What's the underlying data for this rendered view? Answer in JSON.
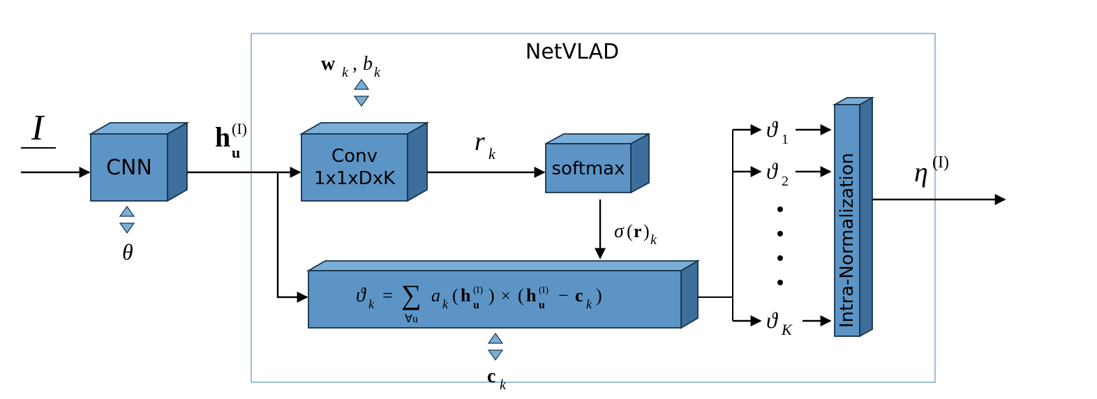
{
  "diagram": {
    "title": "NetVLAD",
    "input_symbol": "I",
    "cnn_label": "CNN",
    "cnn_param": "θ",
    "feature_symbol_base": "h",
    "feature_symbol_sub": "u",
    "feature_symbol_sup": "(I)",
    "conv_line1": "Conv",
    "conv_line2": "1x1xDxK",
    "conv_params_w": "w",
    "conv_params_wk": "k",
    "conv_params_b": "b",
    "conv_params_bk": "k",
    "r_symbol": "r",
    "r_sub": "k",
    "softmax_label": "softmax",
    "sigma_base": "σ",
    "sigma_arg": "(r)",
    "sigma_sub": "k",
    "vlad_formula_lhs_sym": "ϑ",
    "vlad_formula_lhs_sub": "k",
    "vlad_formula_mid_a": "a",
    "vlad_formula_sum_top": "",
    "vlad_formula_sum_bot": "∀u",
    "vlad_center_sym": "c",
    "vlad_center_sub": "k",
    "outputs_sym": "ϑ",
    "outputs_subs": [
      "1",
      "2",
      "K"
    ],
    "norm_label": "Intra-Normalization",
    "eta_base": "η",
    "eta_sup": "(I)"
  }
}
